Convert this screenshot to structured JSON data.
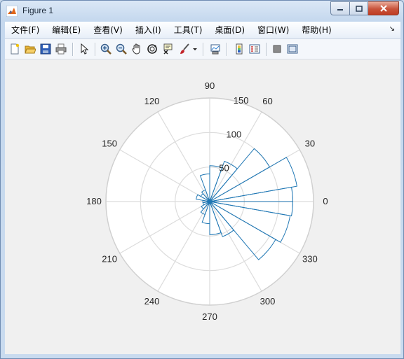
{
  "window": {
    "title": "Figure 1",
    "controls": [
      "minimize",
      "maximize",
      "close"
    ]
  },
  "menu": {
    "items": [
      {
        "label": "文件(F)"
      },
      {
        "label": "编辑(E)"
      },
      {
        "label": "查看(V)"
      },
      {
        "label": "插入(I)"
      },
      {
        "label": "工具(T)"
      },
      {
        "label": "桌面(D)"
      },
      {
        "label": "窗口(W)"
      },
      {
        "label": "帮助(H)"
      }
    ],
    "overflow_icon": "menu-arrow-icon"
  },
  "toolbar": {
    "buttons": [
      "new-figure-icon",
      "open-file-icon",
      "save-icon",
      "print-icon",
      "edit-plot-arrow-icon",
      "zoom-in-icon",
      "zoom-out-icon",
      "pan-hand-icon",
      "rotate-3d-icon",
      "data-cursor-icon",
      "brush-icon",
      "brush-dropdown-icon",
      "link-plot-icon",
      "colorbar-icon",
      "legend-icon",
      "hide-plot-tools-icon",
      "show-plot-tools-icon"
    ]
  },
  "chart_data": {
    "type": "polar-histogram",
    "theta_ticks_deg": [
      "0",
      "30",
      "60",
      "90",
      "120",
      "150",
      "180",
      "210",
      "240",
      "270",
      "300",
      "330"
    ],
    "r_ticks": [
      "50",
      "100",
      "150"
    ],
    "rlim": [
      0,
      150
    ],
    "grid": true,
    "bin_width_deg": 20,
    "series": [
      {
        "edge_color": "#1f77b4",
        "bins": [
          {
            "start_deg": -10,
            "end_deg": 0,
            "r": 120
          },
          {
            "start_deg": 0,
            "end_deg": 10,
            "r": 120
          },
          {
            "start_deg": 10,
            "end_deg": 30,
            "r": 128
          },
          {
            "start_deg": 30,
            "end_deg": 50,
            "r": 100
          },
          {
            "start_deg": 50,
            "end_deg": 70,
            "r": 62
          },
          {
            "start_deg": 70,
            "end_deg": 90,
            "r": 52
          },
          {
            "start_deg": 90,
            "end_deg": 110,
            "r": 40
          },
          {
            "start_deg": 110,
            "end_deg": 130,
            "r": 18
          },
          {
            "start_deg": 130,
            "end_deg": 150,
            "r": 15
          },
          {
            "start_deg": 150,
            "end_deg": 170,
            "r": 20
          },
          {
            "start_deg": 170,
            "end_deg": 190,
            "r": 10
          },
          {
            "start_deg": 190,
            "end_deg": 210,
            "r": 10
          },
          {
            "start_deg": 210,
            "end_deg": 230,
            "r": 14
          },
          {
            "start_deg": 230,
            "end_deg": 250,
            "r": 20
          },
          {
            "start_deg": 250,
            "end_deg": 270,
            "r": 32
          },
          {
            "start_deg": 270,
            "end_deg": 290,
            "r": 48
          },
          {
            "start_deg": 290,
            "end_deg": 310,
            "r": 54
          },
          {
            "start_deg": 310,
            "end_deg": 330,
            "r": 110
          },
          {
            "start_deg": 330,
            "end_deg": 350,
            "r": 118
          }
        ]
      }
    ]
  }
}
